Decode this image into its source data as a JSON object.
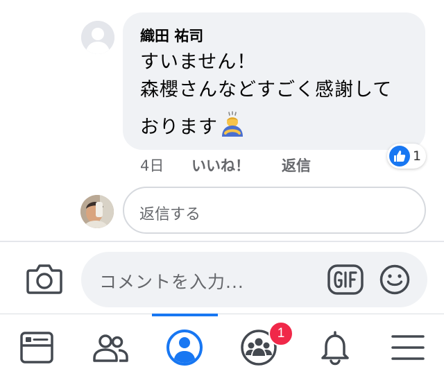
{
  "comment": {
    "author": "織田 祐司",
    "lines": [
      "すいません！",
      "森櫻さんなどすごく感謝して",
      "おります"
    ],
    "emoji": "person-bowing-icon",
    "time": "4日",
    "like_label": "いいね！",
    "reply_label": "返信",
    "reaction_count": "1"
  },
  "reply": {
    "placeholder": "返信する"
  },
  "composer": {
    "placeholder": "コメントを入力..."
  },
  "nav": {
    "items": [
      "feed-icon",
      "friends-icon",
      "profile-icon",
      "groups-icon",
      "notifications-icon",
      "menu-icon"
    ],
    "active": "profile",
    "groups_badge": "1"
  },
  "colors": {
    "accent": "#1877f2",
    "bubble": "#f0f2f5",
    "badge": "#f02849",
    "muted_text": "#65676b"
  }
}
